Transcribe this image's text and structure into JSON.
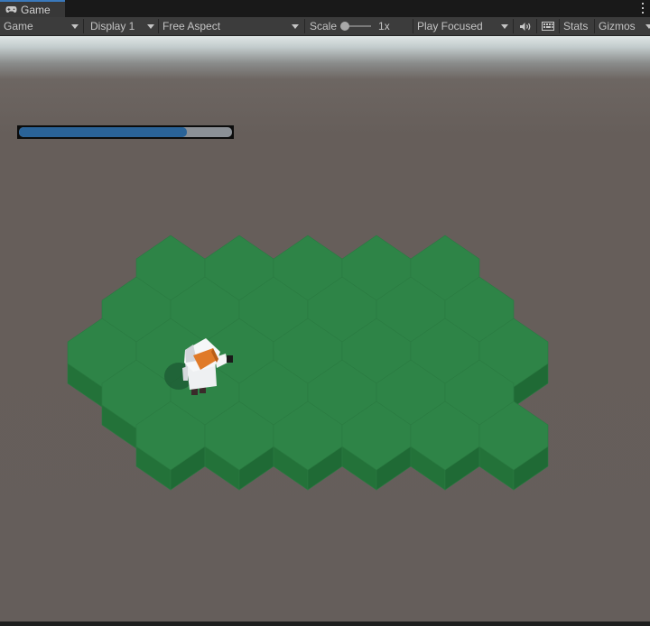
{
  "window": {
    "tab_label": "Game",
    "tab_icon": "gamepad-icon"
  },
  "toolbar": {
    "view_mode": "Game",
    "display": "Display 1",
    "aspect": "Free Aspect",
    "scale_label": "Scale",
    "scale_value": "1x",
    "scale_fraction": 0,
    "play_mode": "Play Focused",
    "audio_icon": "speaker-icon",
    "keyboard_icon": "keyboard-icon",
    "stats_label": "Stats",
    "gizmos_label": "Gizmos"
  },
  "hud": {
    "health_fraction": 0.79,
    "health_fill_color": "#2a6398",
    "health_track_color": "#8b9096"
  },
  "scene": {
    "ground_color": "#665e5a",
    "tile_top_color": "#2e8447",
    "tile_side_color": "#237239",
    "tile_rows": [
      5,
      6,
      7,
      6,
      6
    ],
    "character_icon": "astronaut-icon"
  }
}
